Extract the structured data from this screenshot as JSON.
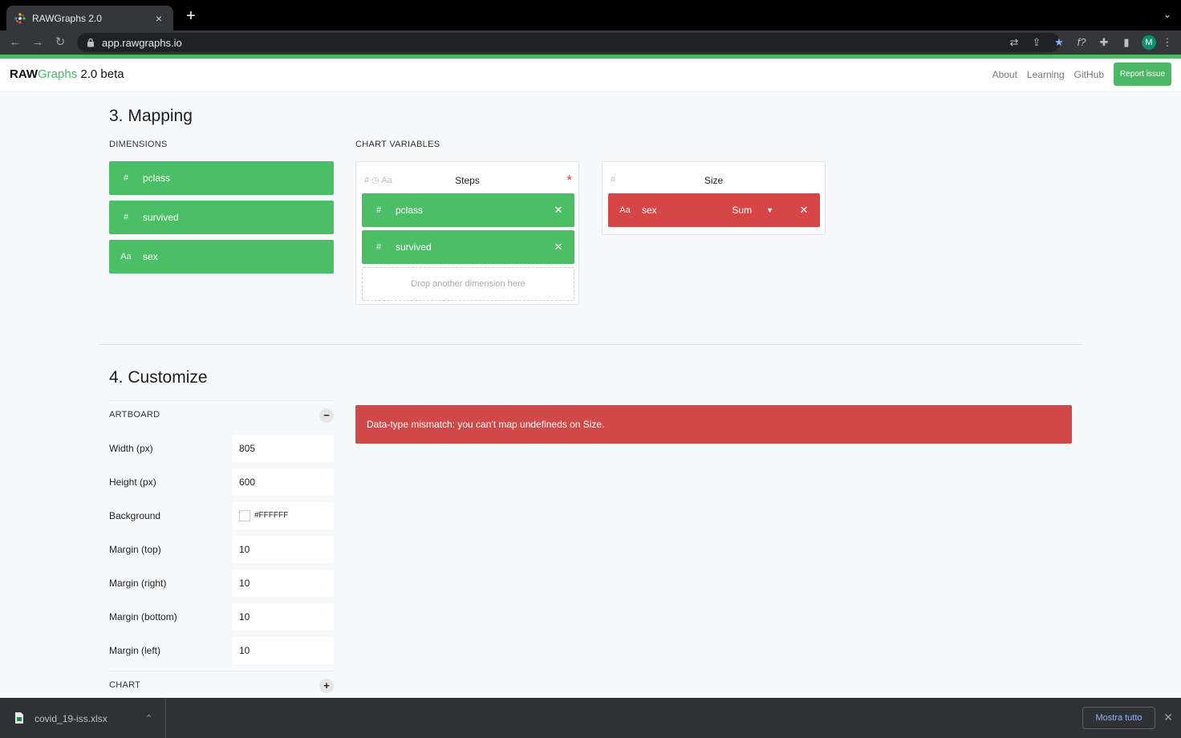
{
  "browser": {
    "tab_title": "RAWGraphs 2.0",
    "tab_close": "×",
    "new_tab": "+",
    "url": "app.rawgraphs.io",
    "profile_initial": "M"
  },
  "header": {
    "logo_raw": "RAW",
    "logo_graphs": "Graphs",
    "logo_version": " 2.0 beta",
    "nav": [
      "About",
      "Learning",
      "GitHub"
    ],
    "report_label": "Report issue"
  },
  "mapping": {
    "title": "3. Mapping",
    "dimensions_label": "DIMENSIONS",
    "dimensions": [
      {
        "type": "#",
        "name": "pclass"
      },
      {
        "type": "#",
        "name": "survived"
      },
      {
        "type": "Aa",
        "name": "sex"
      }
    ],
    "variables_label": "CHART VARIABLES",
    "steps": {
      "types": "#  ◷  Aa",
      "name": "Steps",
      "required": "*",
      "mapped": [
        {
          "type": "#",
          "name": "pclass"
        },
        {
          "type": "#",
          "name": "survived"
        }
      ],
      "dropzone": "Drop another dimension here"
    },
    "size": {
      "types": "#",
      "name": "Size",
      "mapped": {
        "type": "Aa",
        "name": "sex",
        "aggregation": "Sum"
      }
    }
  },
  "customize": {
    "title": "4. Customize",
    "artboard_label": "ARTBOARD",
    "artboard_toggle": "−",
    "options": [
      {
        "label": "Width (px)",
        "value": "805"
      },
      {
        "label": "Height (px)",
        "value": "600"
      },
      {
        "label": "Background",
        "value": "#FFFFFF"
      },
      {
        "label": "Margin (top)",
        "value": "10"
      },
      {
        "label": "Margin (right)",
        "value": "10"
      },
      {
        "label": "Margin (bottom)",
        "value": "10"
      },
      {
        "label": "Margin (left)",
        "value": "10"
      }
    ],
    "chart_label": "CHART",
    "chart_toggle": "+",
    "error": "Data-type mismatch: you can't map undefineds on Size."
  },
  "downloads": {
    "file_name": "covid_19-iss.xlsx",
    "show_all": "Mostra tutto"
  },
  "colors": {
    "accent": "#4cb866",
    "dimension": "#4cbe66",
    "error": "#d14848"
  }
}
